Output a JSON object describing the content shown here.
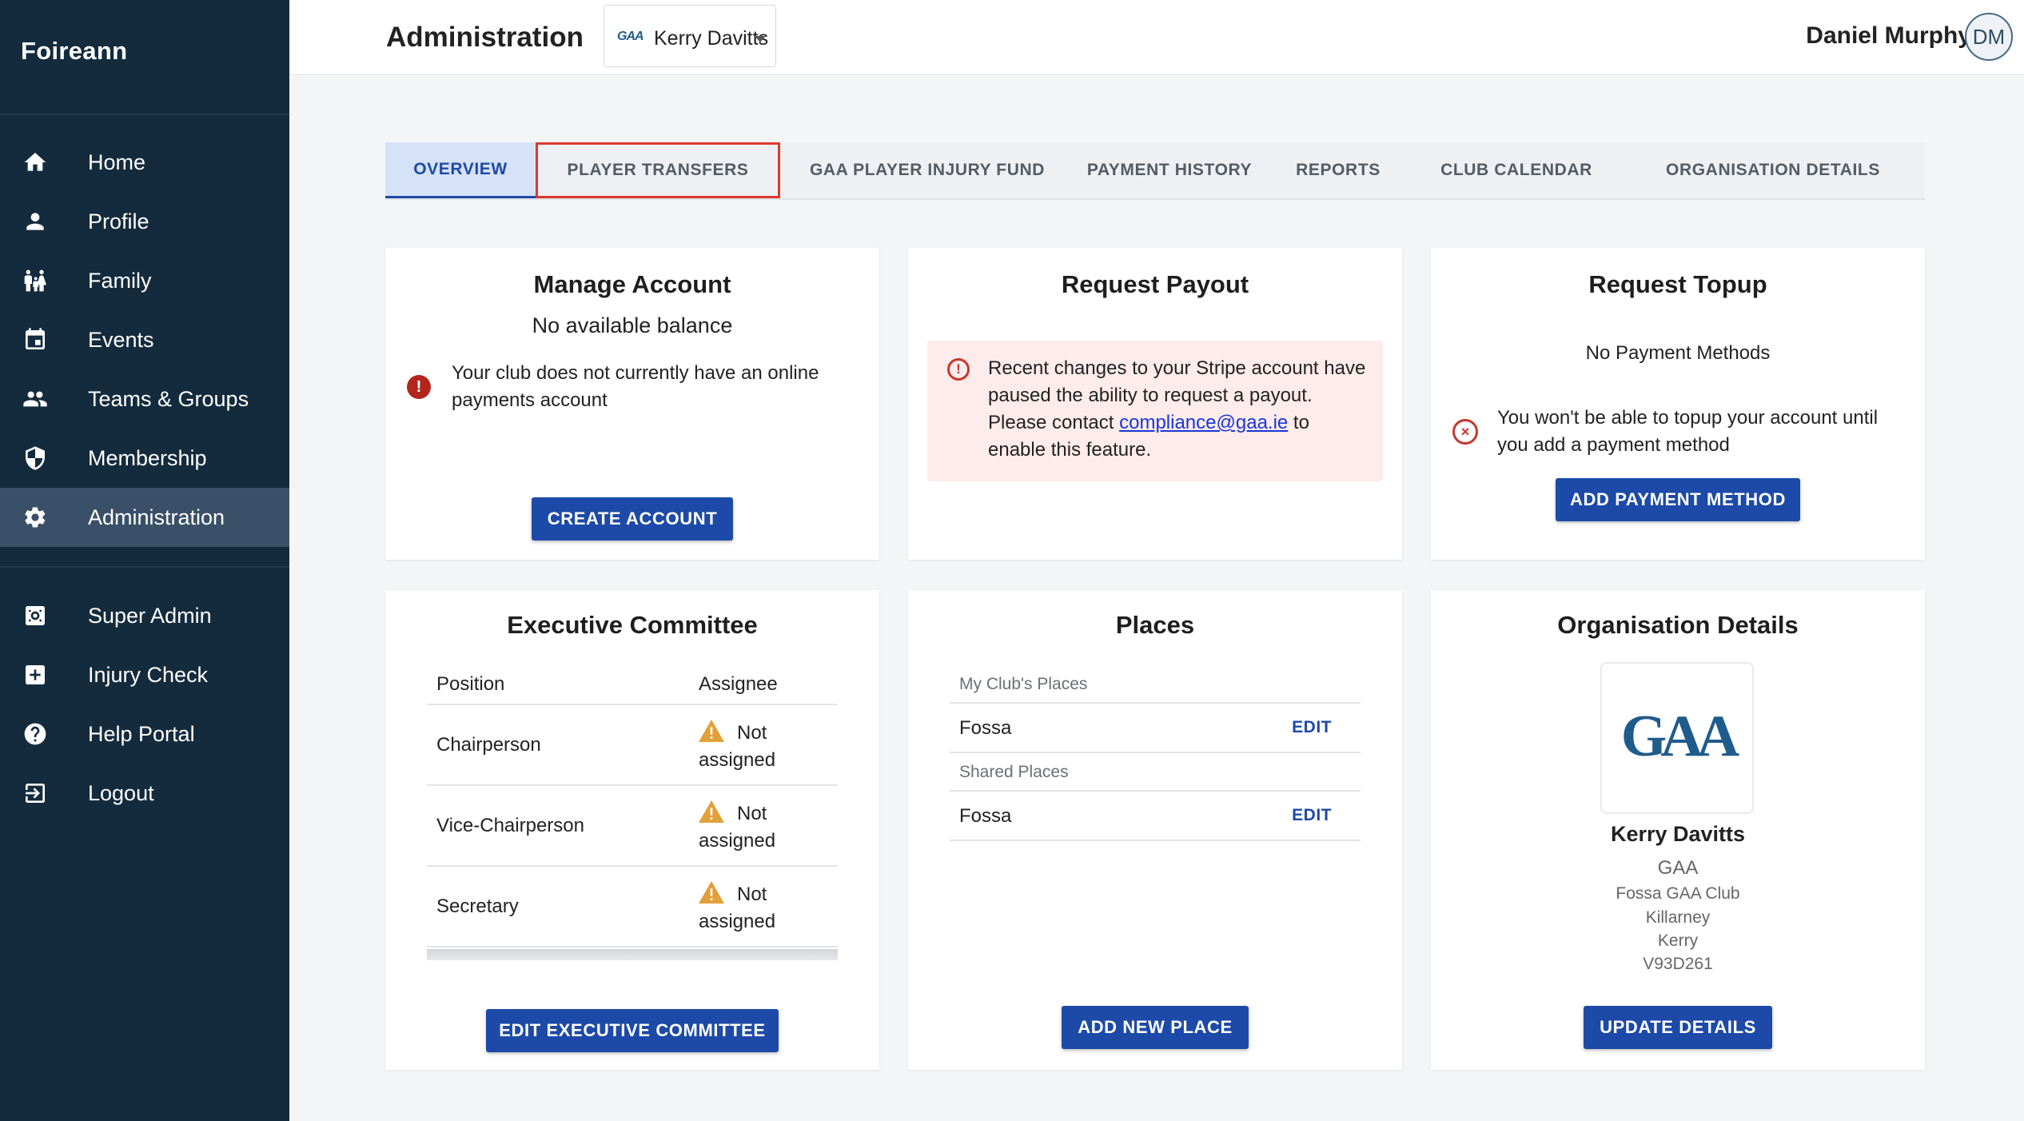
{
  "app": {
    "brand": "Foireann"
  },
  "sidebar": {
    "items": [
      {
        "label": "Home",
        "icon": "home-icon"
      },
      {
        "label": "Profile",
        "icon": "person-icon"
      },
      {
        "label": "Family",
        "icon": "family-icon"
      },
      {
        "label": "Events",
        "icon": "calendar-icon"
      },
      {
        "label": "Teams & Groups",
        "icon": "group-icon"
      },
      {
        "label": "Membership",
        "icon": "shield-icon"
      },
      {
        "label": "Administration",
        "icon": "gear-icon",
        "active": true
      }
    ],
    "secondary_items": [
      {
        "label": "Super Admin",
        "icon": "super-admin-icon"
      },
      {
        "label": "Injury Check",
        "icon": "medical-plus-icon"
      },
      {
        "label": "Help Portal",
        "icon": "help-icon"
      },
      {
        "label": "Logout",
        "icon": "logout-icon"
      }
    ]
  },
  "header": {
    "title": "Administration",
    "org_selector": {
      "logo_text": "GAA",
      "value": "Kerry Davitts"
    },
    "user_name": "Daniel Murphy",
    "user_initials": "DM"
  },
  "tabs": [
    {
      "label": "OVERVIEW",
      "active": true
    },
    {
      "label": "PLAYER TRANSFERS",
      "highlighted": true
    },
    {
      "label": "GAA PLAYER INJURY FUND"
    },
    {
      "label": "PAYMENT HISTORY"
    },
    {
      "label": "REPORTS"
    },
    {
      "label": "CLUB CALENDAR"
    },
    {
      "label": "ORGANISATION DETAILS"
    }
  ],
  "manage_account": {
    "title": "Manage Account",
    "balance": "No available balance",
    "message": "Your club does not currently have an online payments account",
    "button": "CREATE ACCOUNT"
  },
  "request_payout": {
    "title": "Request Payout",
    "alert_before": "Recent changes to your Stripe account have paused the ability to request a payout. Please contact ",
    "alert_link": "compliance@gaa.ie",
    "alert_after": " to enable this feature."
  },
  "request_topup": {
    "title": "Request Topup",
    "status": "No Payment Methods",
    "message": "You won't be able to topup your account until you add a payment method",
    "button": "ADD PAYMENT METHOD"
  },
  "executive_committee": {
    "title": "Executive Committee",
    "columns": [
      "Position",
      "Assignee"
    ],
    "rows": [
      {
        "position": "Chairperson",
        "assignee": "Not assigned"
      },
      {
        "position": "Vice-Chairperson",
        "assignee": "Not assigned"
      },
      {
        "position": "Secretary",
        "assignee": "Not assigned"
      }
    ],
    "button": "EDIT EXECUTIVE COMMITTEE"
  },
  "places": {
    "title": "Places",
    "my_places_header": "My Club's Places",
    "my_places": [
      {
        "name": "Fossa",
        "action": "EDIT"
      }
    ],
    "shared_places_header": "Shared Places",
    "shared_places": [
      {
        "name": "Fossa",
        "action": "EDIT"
      }
    ],
    "button": "ADD NEW PLACE"
  },
  "organisation_details": {
    "title": "Organisation Details",
    "logo_text": "GAA",
    "name": "Kerry Davitts",
    "body": "GAA",
    "club": "Fossa GAA Club",
    "town": "Killarney",
    "county": "Kerry",
    "eircode": "V93D261",
    "button": "UPDATE DETAILS"
  },
  "colors": {
    "sidebar_bg": "#142b3d",
    "sidebar_active": "#3a5068",
    "primary": "#1d4aa8",
    "error": "#b3261e",
    "warning": "#e0a13a",
    "highlight_outline": "#dc3a2c"
  }
}
